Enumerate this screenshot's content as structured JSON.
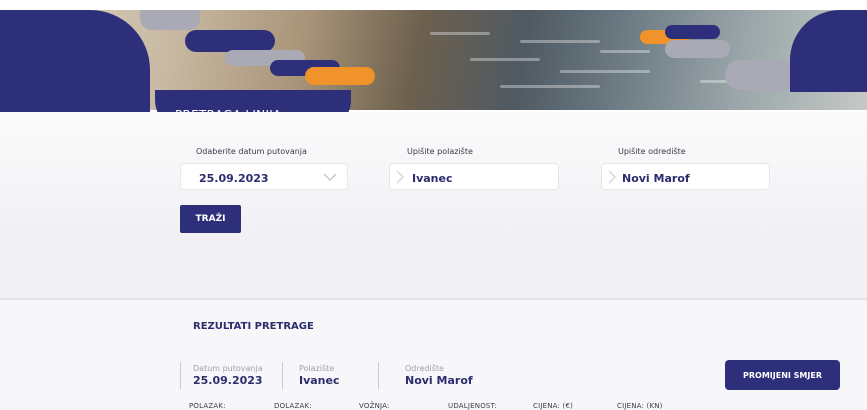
{
  "header": {
    "section_title": "PRETRAGA LINIJA"
  },
  "search_form": {
    "date_label": "Odaberite datum putovanja",
    "date_value": "25.09.2023",
    "origin_label": "Upišite polazište",
    "origin_value": "Ivanec",
    "destination_label": "Upišite odredište",
    "destination_value": "Novi Marof",
    "search_button": "TRAŽI"
  },
  "results": {
    "title": "REZULTATI PRETRAGE",
    "summary": {
      "date_label": "Datum putovanja",
      "date_value": "25.09.2023",
      "origin_label": "Polazište",
      "origin_value": "Ivanec",
      "destination_label": "Odredište",
      "destination_value": "Novi Marof"
    },
    "swap_button": "PROMIJENI SMJER",
    "columns": [
      "POLAZAK:",
      "DOLAZAK:",
      "VOŽNJA:",
      "UDALJENOST:",
      "CIJENA: (€)",
      "CIJENA: (KN)"
    ]
  },
  "colors": {
    "brand_navy": "#2d2f7a",
    "accent_orange": "#f0932a",
    "accent_grey": "#a9aab5"
  },
  "icons": {
    "date_dropdown": "chevron-down-icon",
    "origin": "chevron-right-icon",
    "destination": "chevron-right-icon"
  }
}
